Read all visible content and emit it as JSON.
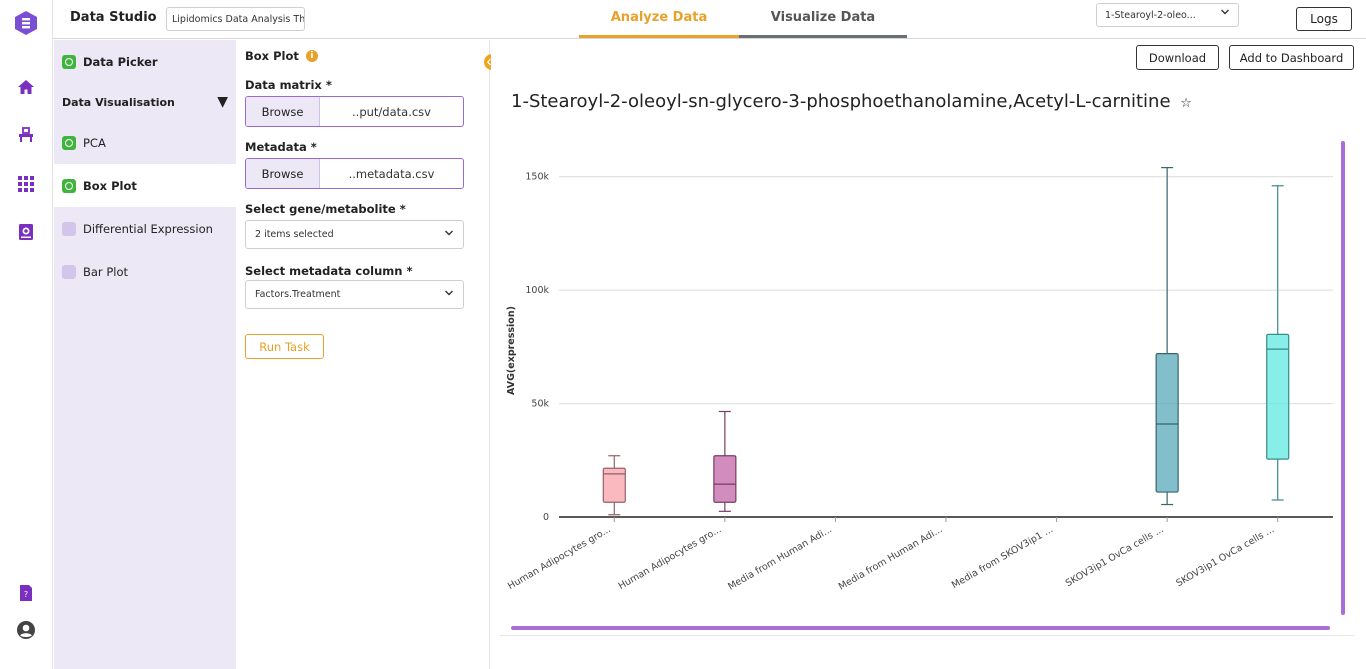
{
  "header": {
    "brand": "Data Studio",
    "analysis_name": "Lipidomics Data Analysis Th",
    "tabs": [
      "Analyze Data",
      "Visualize Data"
    ],
    "metabolite_select": "1-Stearoyl-2-oleo...",
    "logs_label": "Logs"
  },
  "rail": {
    "icons": [
      "logo-icon",
      "home-icon",
      "desk-icon",
      "apps-grid-icon",
      "media-icon",
      "help-doc-icon",
      "account-icon"
    ]
  },
  "sidebar": {
    "items": [
      {
        "label": "Data Picker",
        "done": true
      },
      {
        "label": "Data Visualisation",
        "section": true
      },
      {
        "label": "PCA",
        "done": true
      },
      {
        "label": "Box Plot",
        "done": true
      },
      {
        "label": "Differential Expression",
        "done": false
      },
      {
        "label": "Bar Plot",
        "done": false
      }
    ],
    "section_toggle": "▼"
  },
  "form": {
    "title": "Box Plot",
    "info": "i",
    "data_matrix_label": "Data matrix *",
    "data_matrix_browse": "Browse",
    "data_matrix_file": "..put/data.csv",
    "metadata_label": "Metadata *",
    "metadata_browse": "Browse",
    "metadata_file": "..metadata.csv",
    "gene_label": "Select gene/metabolite *",
    "gene_value": "2 items selected",
    "column_label": "Select metadata column *",
    "column_value": "Factors.Treatment",
    "run_label": "Run Task"
  },
  "main": {
    "download_label": "Download",
    "dashboard_label": "Add to Dashboard",
    "plot_title": "1-Stearoyl-2-oleoyl-sn-glycero-3-phosphoethanolamine,Acetyl-L-carnitine",
    "star": "☆"
  },
  "chart_data": {
    "type": "box",
    "ylabel": "AVG(expression)",
    "ylim": [
      0,
      160000
    ],
    "yticks": [
      0,
      50000,
      100000,
      150000
    ],
    "ytick_labels": [
      "0",
      "50k",
      "100k",
      "150k"
    ],
    "grid": true,
    "categories": [
      "Human Adipocytes gro...",
      "Human Adipocytes gro...",
      "Media from Human Adi...",
      "Media from Human Adi...",
      "Media from SKOV3ip1 ...",
      "SKOV3ip1 OvCa cells ...",
      "SKOV3ip1 OvCa cells ..."
    ],
    "boxes": [
      {
        "min": 1000,
        "q1": 6500,
        "median": 19000,
        "q3": 21500,
        "max": 27000,
        "color": "#f7a1a8"
      },
      {
        "min": 2500,
        "q1": 6500,
        "median": 14500,
        "q3": 27000,
        "max": 46500,
        "color": "#c466a8"
      },
      null,
      null,
      null,
      {
        "min": 5500,
        "q1": 11000,
        "median": 41000,
        "q3": 72000,
        "max": 154000,
        "color": "#5aaab8"
      },
      {
        "min": 7500,
        "q1": 25500,
        "median": 74000,
        "q3": 80500,
        "max": 146000,
        "color": "#5fe8e0"
      }
    ]
  }
}
